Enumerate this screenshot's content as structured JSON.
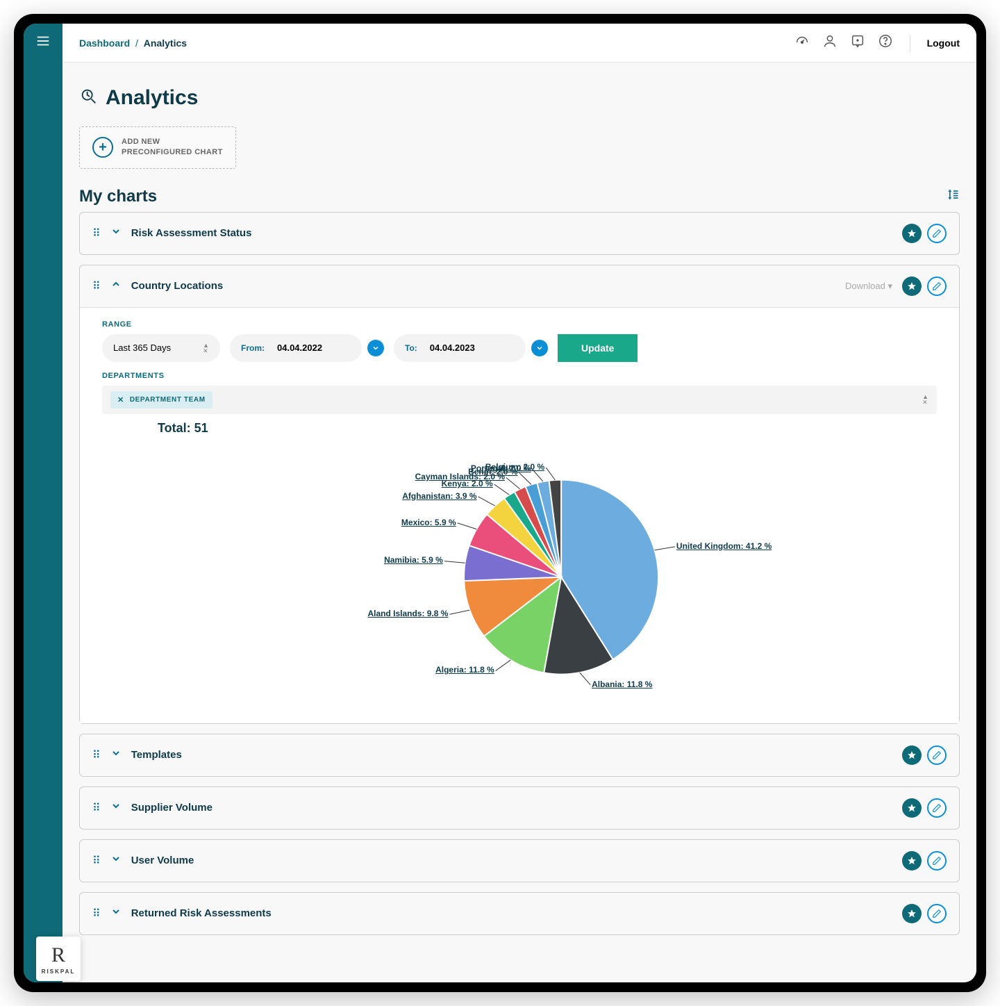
{
  "breadcrumb": {
    "parent": "Dashboard",
    "current": "Analytics"
  },
  "topbar": {
    "logout": "Logout"
  },
  "page": {
    "title": "Analytics"
  },
  "add_chart": {
    "line1": "ADD NEW",
    "line2": "PRECONFIGURED CHART"
  },
  "section": {
    "title": "My charts"
  },
  "charts": [
    {
      "title": "Risk Assessment Status"
    },
    {
      "title": "Country Locations",
      "download": "Download"
    },
    {
      "title": "Templates"
    },
    {
      "title": "Supplier Volume"
    },
    {
      "title": "User Volume"
    },
    {
      "title": "Returned Risk Assessments"
    }
  ],
  "filters": {
    "range_label": "RANGE",
    "range_value": "Last 365 Days",
    "from_label": "From:",
    "from_value": "04.04.2022",
    "to_label": "To:",
    "to_value": "04.04.2023",
    "update": "Update",
    "dept_label": "DEPARTMENTS",
    "dept_chip": "DEPARTMENT TEAM"
  },
  "chart_data": {
    "type": "pie",
    "title": "Country Locations",
    "total_label": "Total: 51",
    "series": [
      {
        "name": "United Kingdom",
        "value": 41.2,
        "color": "#6cacde"
      },
      {
        "name": "Albania",
        "value": 11.8,
        "color": "#3a3f44"
      },
      {
        "name": "Algeria",
        "value": 11.8,
        "color": "#79d265"
      },
      {
        "name": "Aland Islands",
        "value": 9.8,
        "color": "#f08a3c"
      },
      {
        "name": "Namibia",
        "value": 5.9,
        "color": "#7a6ed1"
      },
      {
        "name": "Mexico",
        "value": 5.9,
        "color": "#e94f7a"
      },
      {
        "name": "Afghanistan",
        "value": 3.9,
        "color": "#f4d43e"
      },
      {
        "name": "Kenya",
        "value": 2.0,
        "color": "#1aa88a"
      },
      {
        "name": "Cayman Islands",
        "value": 2.0,
        "color": "#d64b4b"
      },
      {
        "name": "Benin",
        "value": 2.0,
        "color": "#4a9ed6"
      },
      {
        "name": "Portugal",
        "value": 2.0,
        "color": "#6cacde"
      },
      {
        "name": "Belgium",
        "value": 2.0,
        "color": "#444444"
      }
    ]
  },
  "logo": {
    "brand": "RISKPAL"
  }
}
